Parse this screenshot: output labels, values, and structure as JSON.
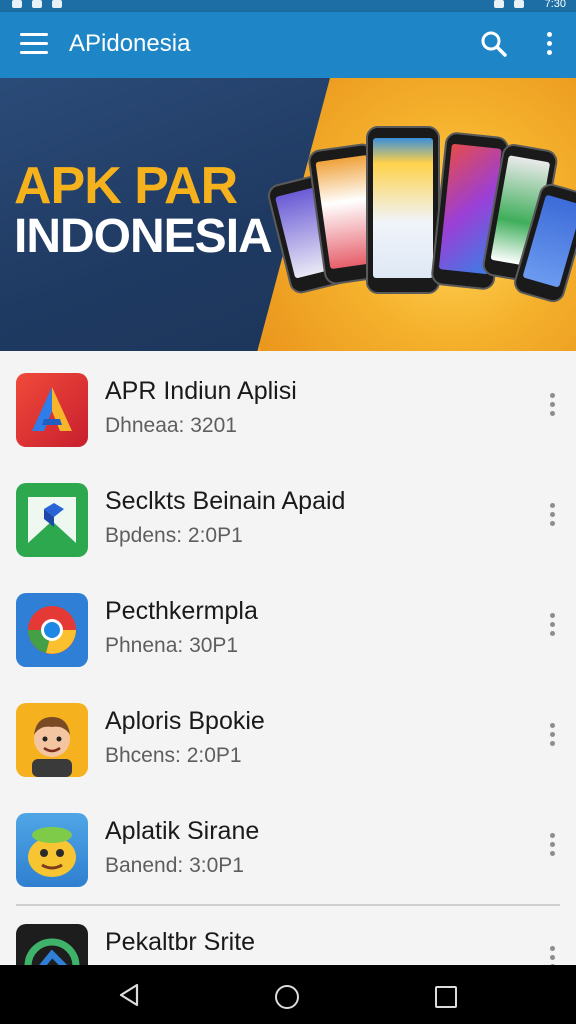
{
  "status_bar": {
    "time": "7:30",
    "icons": [
      "notification-icon",
      "sim-icon",
      "shield-icon",
      "wifi-icon",
      "battery-icon"
    ]
  },
  "app_bar": {
    "title": "APidonesia",
    "icons": [
      "menu-icon",
      "search-icon",
      "more-vertical-icon"
    ]
  },
  "banner": {
    "line1": "APK PAR",
    "line2": "INDONESIA"
  },
  "apps": [
    {
      "name": "APR Indiun Aplisi",
      "subtitle": "Dhneaa: 3201",
      "icon": "red-a-app-icon"
    },
    {
      "name": "Seclkts Beinain Apaid",
      "subtitle": "Bpdens: 2:0P1",
      "icon": "green-box-app-icon"
    },
    {
      "name": "Pecthkermpla",
      "subtitle": "Phnena: 30P1",
      "icon": "chrome-app-icon"
    },
    {
      "name": "Aploris Bpokie",
      "subtitle": "Bhcens: 2:0P1",
      "icon": "cartoon-boy-app-icon"
    },
    {
      "name": "Aplatik Sirane",
      "subtitle": "Banend: 3:0P1",
      "icon": "frog-app-icon"
    },
    {
      "name": "Pekaltbr Srite",
      "subtitle": "",
      "icon": "dark-app-icon"
    }
  ],
  "colors": {
    "app_bar": "#1e86c6",
    "banner_dark": "#1f3a62",
    "banner_accent": "#f5b21c",
    "list_background": "#f4f4f4",
    "nav_bar": "#000000"
  },
  "nav": {
    "icons": [
      "back-icon",
      "home-icon",
      "recents-icon"
    ]
  }
}
